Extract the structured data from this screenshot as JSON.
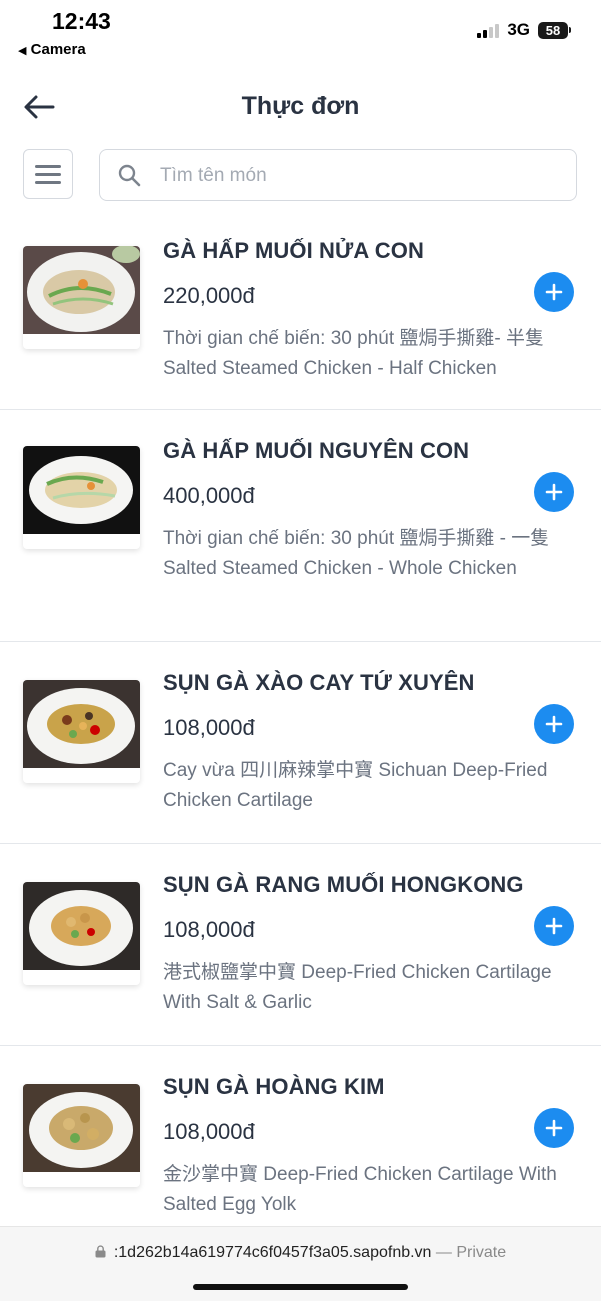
{
  "status_bar": {
    "time": "12:43",
    "back_app": "Camera",
    "network": "3G",
    "battery": "58"
  },
  "header": {
    "title": "Thực đơn"
  },
  "search": {
    "placeholder": "Tìm tên món",
    "value": ""
  },
  "items": [
    {
      "name": "GÀ HẤP MUỐI NỬA CON",
      "price": "220,000đ",
      "description": "Thời gian chế biến: 30 phút 鹽焗手撕雞- 半隻 Salted Steamed Chicken - Half Chicken"
    },
    {
      "name": "GÀ HẤP MUỐI NGUYÊN CON",
      "price": "400,000đ",
      "description": "Thời gian chế biến: 30 phút 鹽焗手撕雞 - 一隻 Salted Steamed Chicken - Whole Chicken"
    },
    {
      "name": "SỤN GÀ XÀO CAY TỨ XUYÊN",
      "price": "108,000đ",
      "description": "Cay vừa 四川麻辣掌中寶 Sichuan Deep-Fried Chicken Cartilage"
    },
    {
      "name": "SỤN GÀ RANG MUỐI HONGKONG",
      "price": "108,000đ",
      "description": "港式椒鹽掌中寶 Deep-Fried Chicken Cartilage With Salt & Garlic"
    },
    {
      "name": "SỤN GÀ HOÀNG KIM",
      "price": "108,000đ",
      "description": "金沙掌中寶 Deep-Fried Chicken Cartilage With Salted Egg Yolk"
    }
  ],
  "browser": {
    "url": ":1d262b14a619774c6f0457f3a05.sapofnb.vn",
    "privacy": "— Private"
  },
  "colors": {
    "accent": "#1c8cf0",
    "text": "#2a3342",
    "muted": "#6b7380",
    "divider": "#e4e7eb"
  }
}
